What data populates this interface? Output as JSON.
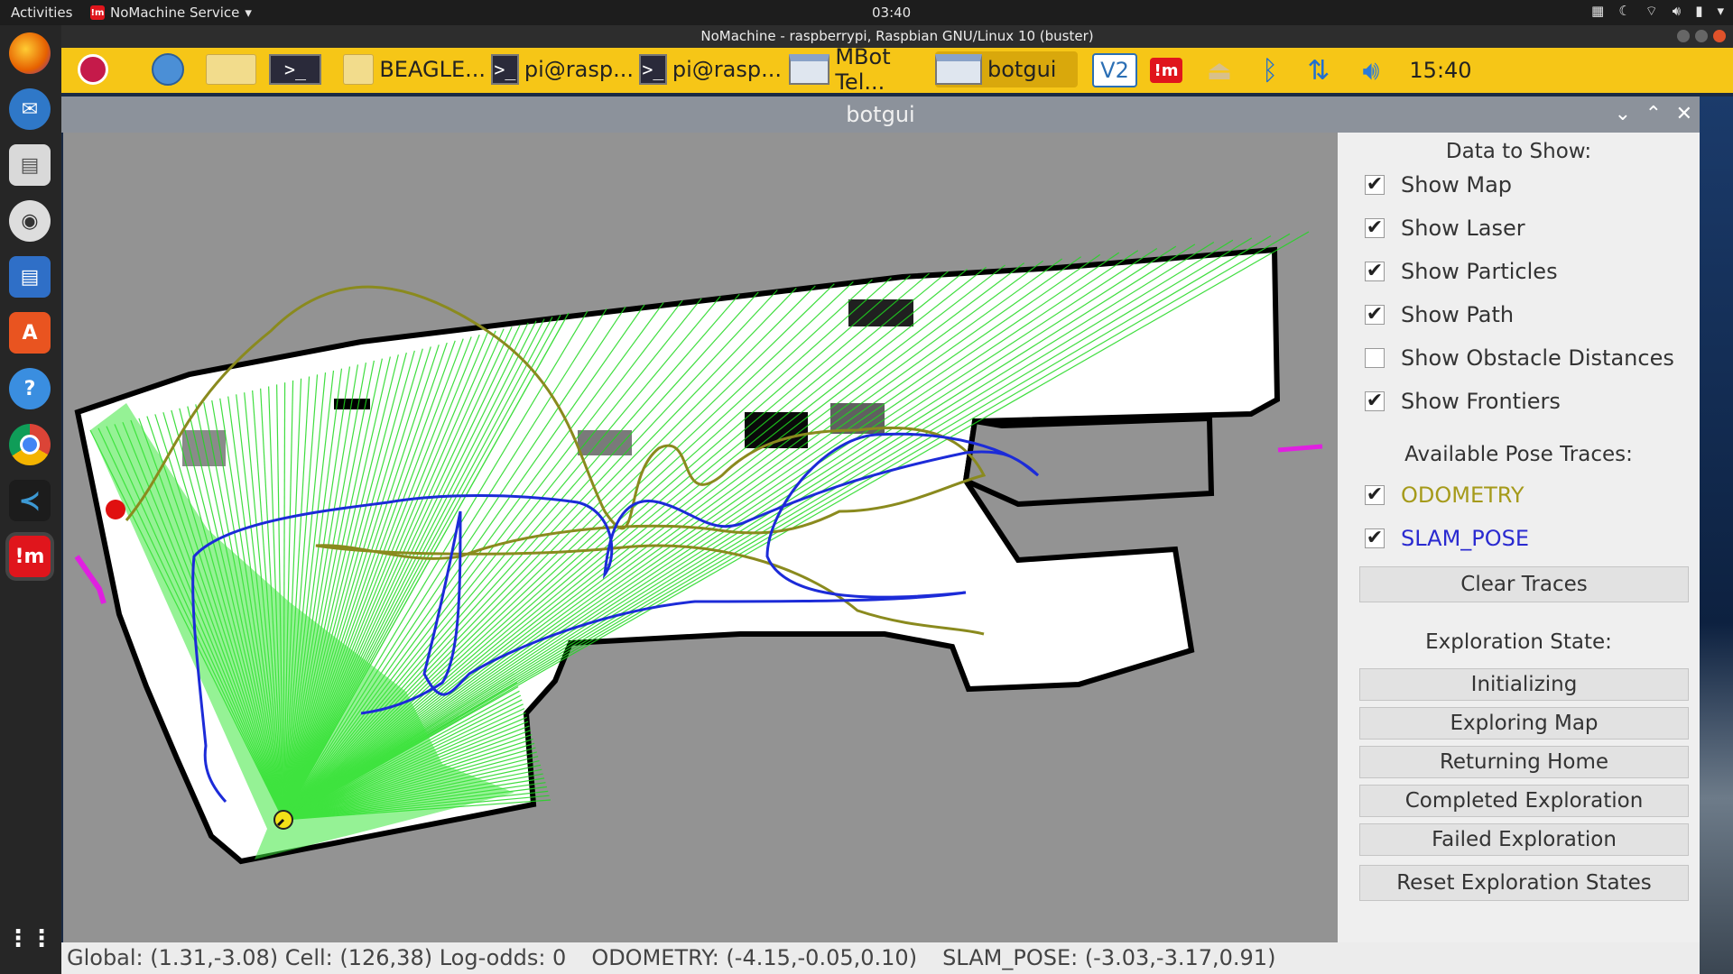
{
  "topbar": {
    "activities": "Activities",
    "app_name": "NoMachine Service",
    "clock": "03:40"
  },
  "window": {
    "title": "NoMachine - raspberrypi, Raspbian GNU/Linux 10 (buster)"
  },
  "remote_panel": {
    "tasks": [
      {
        "label": "BEAGLE..."
      },
      {
        "label": "pi@rasp..."
      },
      {
        "label": "pi@rasp..."
      },
      {
        "label": "MBot Tel..."
      },
      {
        "label": "botgui"
      }
    ],
    "clock": "15:40",
    "vnc_label": "V2",
    "nm_label": "!m"
  },
  "botgui": {
    "title": "botgui",
    "data_header": "Data to Show:",
    "options": [
      {
        "label": "Show Map",
        "checked": "✔"
      },
      {
        "label": "Show Laser",
        "checked": "✔"
      },
      {
        "label": "Show Particles",
        "checked": "✔"
      },
      {
        "label": "Show Path",
        "checked": "✔"
      },
      {
        "label": "Show Obstacle Distances",
        "checked": ""
      },
      {
        "label": "Show Frontiers",
        "checked": "✔"
      }
    ],
    "traces_header": "Available Pose Traces:",
    "traces": [
      {
        "label": "ODOMETRY",
        "checked": "✔",
        "color": "#a59a1a"
      },
      {
        "label": "SLAM_POSE",
        "checked": "✔",
        "color": "#2a2ad0"
      }
    ],
    "clear_button": "Clear Traces",
    "exploration_header": "Exploration State:",
    "states": [
      "Initializing",
      "Exploring Map",
      "Returning Home",
      "Completed Exploration",
      "Failed Exploration"
    ],
    "reset_button": "Reset Exploration States",
    "status": {
      "global": "Global: (1.31,-3.08) Cell: (126,38) Log-odds: 0",
      "odometry": "ODOMETRY: (-4.15,-0.05,0.10)",
      "slam": "SLAM_POSE: (-3.03,-3.17,0.91)"
    }
  }
}
